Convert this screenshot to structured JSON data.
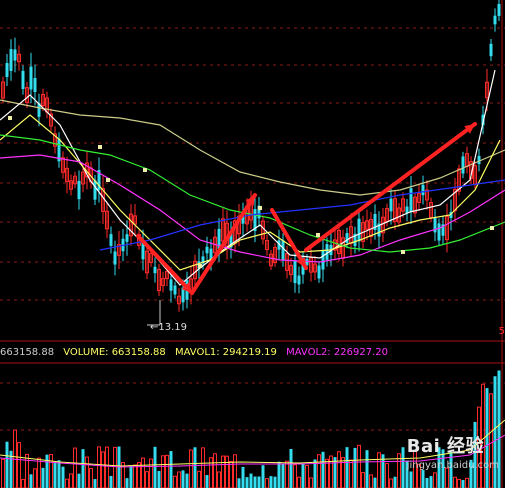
{
  "chart_data": {
    "type": "candlestick",
    "price_panel": {
      "low_annotation": "13.19",
      "colors": {
        "up": "#ff2a2a",
        "down": "#33ddee",
        "ma_white": "#ffffff",
        "ma_yellow": "#ffff66",
        "ma_magenta": "#ff33ff",
        "ma_green": "#33ee33",
        "ma_blue": "#2233ff",
        "ma_long": "#cccc88",
        "arrows": "#ff2222",
        "grid": "#8b1a1a"
      }
    },
    "volume_panel": {
      "labels": {
        "cut_value": "663158.88",
        "volume_label": "VOLUME: 663158.88",
        "mavol1_label": "MAVOL1: 294219.19",
        "mavol2_label": "MAVOL2: 226927.20"
      },
      "volume": 663158.88,
      "mavol1": 294219.19,
      "mavol2": 226927.2
    }
  },
  "watermark": {
    "main": "Bai 经验",
    "sub": "jingyan.baidu.com"
  },
  "edge_text": "5"
}
